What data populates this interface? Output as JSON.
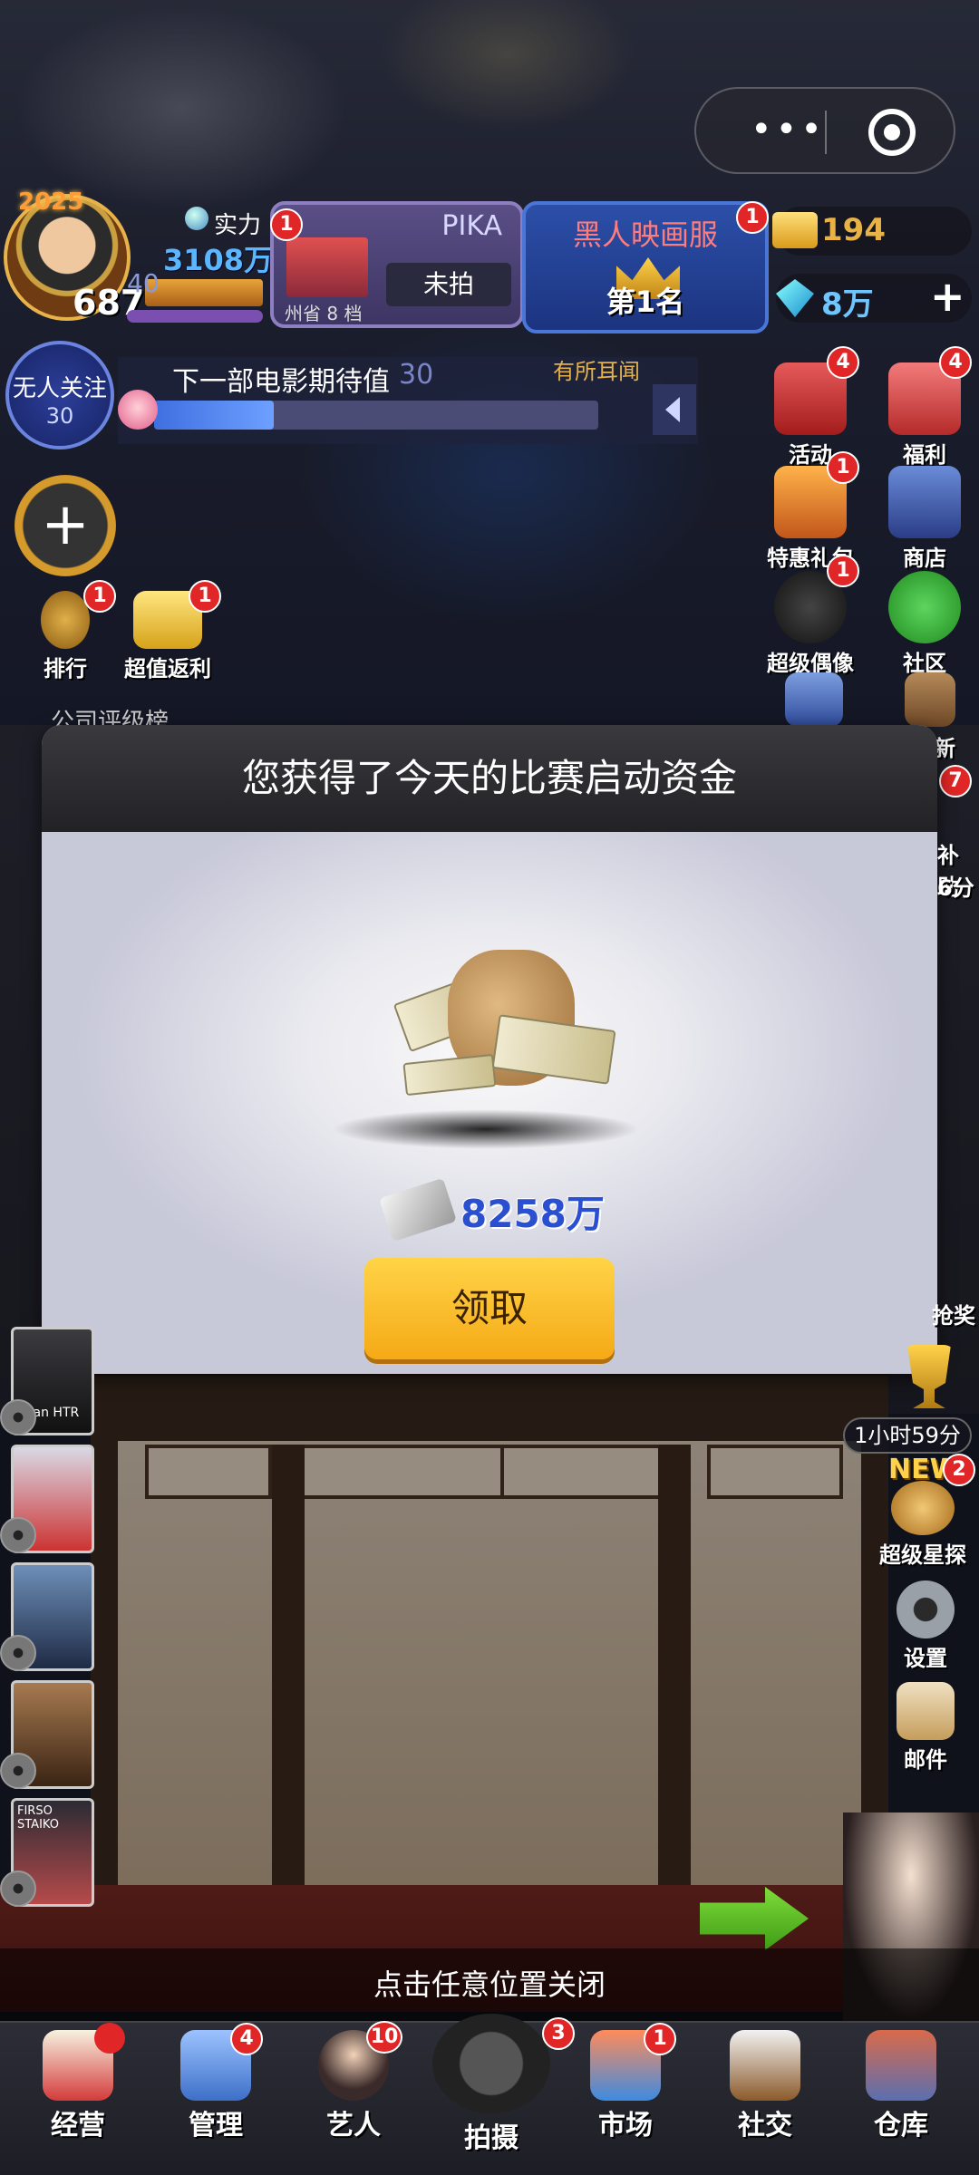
{
  "capsule": {
    "more_glyph": "•••"
  },
  "player": {
    "year_badge": "2025",
    "level": "687",
    "power_label": "实力",
    "power_value": "3108万",
    "xp_partial": "40"
  },
  "studio_card": {
    "name": "PIKA",
    "tier": "州省 8 档",
    "status": "未拍",
    "badge": "1"
  },
  "ranking_card": {
    "title": "黑人映画服",
    "place": "第1名",
    "badge": "1"
  },
  "currency": {
    "tickets": "194",
    "gems": "8万"
  },
  "follow": {
    "label": "无人关注",
    "count": "30"
  },
  "next_movie": {
    "title": "下一部电影期待值",
    "value": "30",
    "hint": "有所耳闻",
    "progress": 0.27
  },
  "left_buttons": [
    {
      "label": "排行",
      "badge": "1"
    },
    {
      "label": "超值返利",
      "badge": "1"
    }
  ],
  "right_buttons": [
    {
      "label": "活动",
      "badge": "4"
    },
    {
      "label": "福利",
      "badge": "4"
    },
    {
      "label": "特惠礼包",
      "badge": "1"
    },
    {
      "label": "商店",
      "badge": ""
    },
    {
      "label": "超级偶像",
      "badge": "1"
    },
    {
      "label": "社区",
      "badge": ""
    },
    {
      "label": "新",
      "badge": ""
    },
    {
      "label": "补助",
      "badge": "7"
    },
    {
      "label": "6分",
      "badge": ""
    },
    {
      "label": "抢奖",
      "badge": ""
    },
    {
      "label": "超级星探",
      "badge": "2"
    },
    {
      "label": "设置",
      "badge": ""
    },
    {
      "label": "邮件",
      "badge": ""
    }
  ],
  "timer": "1小时59分",
  "new_tag": "NEW",
  "company_label": "公司评级榜",
  "dialog": {
    "title": "您获得了今天的比赛启动资金",
    "amount": "8258万",
    "claim_label": "领取"
  },
  "movies": [
    "Kaan HTR",
    "",
    "",
    "",
    "FIRSO STAIKO"
  ],
  "close_hint": "点击任意位置关闭",
  "bottom_nav": [
    {
      "label": "经营",
      "badge": ""
    },
    {
      "label": "管理",
      "badge": "4"
    },
    {
      "label": "艺人",
      "badge": "10"
    },
    {
      "label": "拍摄",
      "badge": "3"
    },
    {
      "label": "市场",
      "badge": "1"
    },
    {
      "label": "社交",
      "badge": ""
    },
    {
      "label": "仓库",
      "badge": ""
    }
  ],
  "colors": {
    "accent_gold": "#f5a916",
    "power_blue": "#5ab6ff",
    "badge_red": "#e02626",
    "amount_blue": "#2a4fd0"
  }
}
